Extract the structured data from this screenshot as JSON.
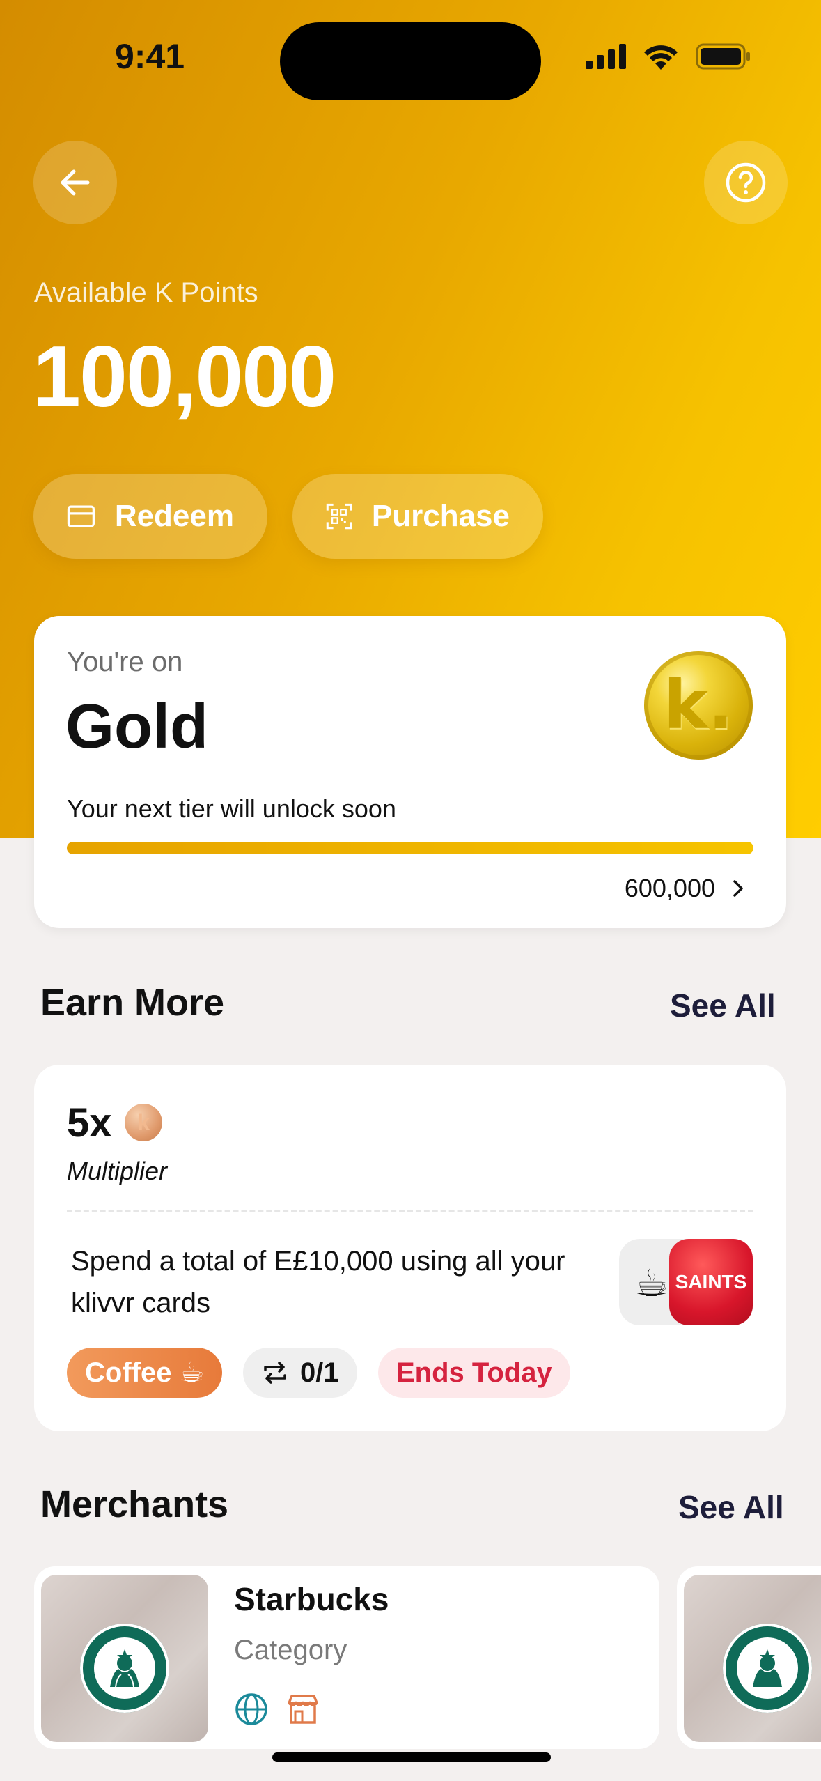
{
  "status_bar": {
    "time": "9:41"
  },
  "header": {
    "available_label": "Available K Points",
    "points": "100,000",
    "redeem_label": "Redeem",
    "purchase_label": "Purchase"
  },
  "tier": {
    "youre_on": "You're on",
    "name": "Gold",
    "coin_letter": "k.",
    "next_message": "Your next tier will unlock soon",
    "target": "600,000",
    "progress_fraction": 1.0
  },
  "earn_more": {
    "title": "Earn More",
    "see_all": "See All",
    "multiplier_value": "5x",
    "multiplier_label": "Multiplier",
    "description": "Spend a total of E£10,000 using all your klivvr cards",
    "brand_label": "SAINTS",
    "chips": {
      "category": "Coffee ☕",
      "progress": "0/1",
      "deadline": "Ends Today"
    }
  },
  "merchants": {
    "title": "Merchants",
    "see_all": "See All",
    "items": [
      {
        "name": "Starbucks",
        "category": "Category"
      }
    ]
  },
  "colors": {
    "hero_start": "#d48c00",
    "hero_end": "#ffcd00",
    "accent_orange": "#e77a3a",
    "ends_red": "#d5233f",
    "starbucks_green": "#0f6b58"
  },
  "icons": [
    "back-arrow-icon",
    "help-icon",
    "card-icon",
    "qr-scan-icon",
    "chevron-right-icon",
    "repeat-icon",
    "globe-icon",
    "store-icon",
    "signal-icon",
    "wifi-icon",
    "battery-icon"
  ]
}
